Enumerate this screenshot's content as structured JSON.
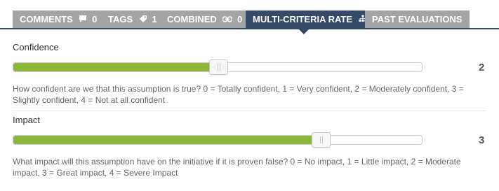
{
  "tabs": [
    {
      "label": "COMMENTS",
      "icon": "comment-icon",
      "count": "0"
    },
    {
      "label": "TAGS",
      "icon": "tag-icon",
      "count": "1"
    },
    {
      "label": "COMBINED",
      "icon": "link-icon",
      "count": "0"
    },
    {
      "label": "MULTI-CRITERIA RATE",
      "icon": "hierarchy-icon"
    },
    {
      "label": "PAST EVALUATIONS"
    }
  ],
  "active_tab": "MULTI-CRITERIA RATE",
  "criteria": [
    {
      "label": "Confidence",
      "value": "2",
      "level": 0.5,
      "description": "How confident are we that this assumption is true? 0 = Totally confident, 1 = Very confident, 2 = Moderately confident, 3 = Slightly confident, 4 = Not at all confident"
    },
    {
      "label": "Impact",
      "value": "3",
      "level": 0.75,
      "description": "What impact will this assumption have on the initiative if it is proven false?  0 = No impact, 1 = Little impact, 2 = Moderate impact, 3 = Great impact, 4 = Severe Impact"
    }
  ],
  "colors": {
    "tab_inactive": "#a4a4a4",
    "tab_active": "#344a67",
    "slider_fill": "#8cb63c"
  }
}
